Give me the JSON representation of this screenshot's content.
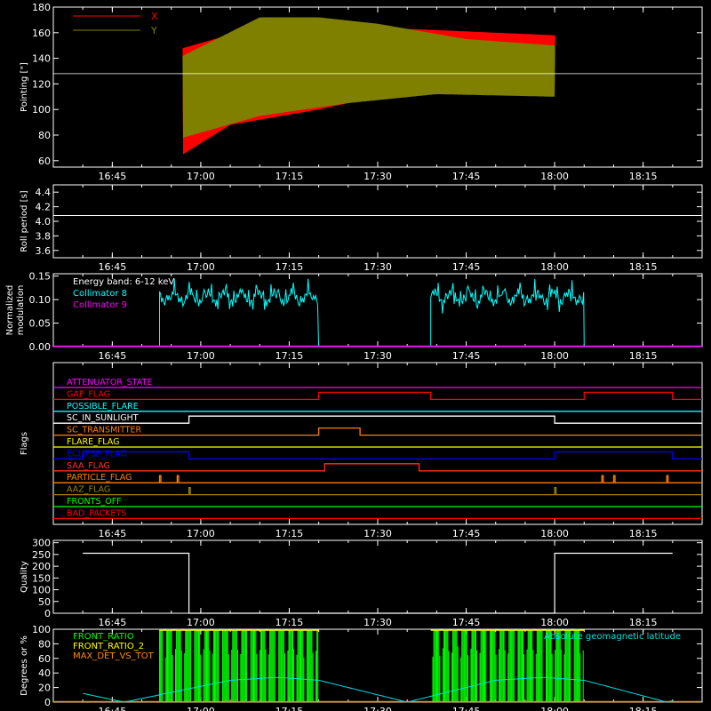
{
  "colors": {
    "background": "#000000",
    "axes": "#ffffff",
    "pointing_x": "#ff0000",
    "pointing_y": "#808000",
    "collimator_8": "#00ffff",
    "collimator_9": "#ff00ff",
    "front_ratio": "#00ff00",
    "front_ratio_2": "#ffff00",
    "max_det_vs_tot": "#ff8c00",
    "geomag": "#00e0e0"
  },
  "time_ticks": [
    "16:45",
    "17:00",
    "17:15",
    "17:30",
    "17:45",
    "18:00",
    "18:15"
  ],
  "chart_data": [
    {
      "type": "line",
      "panel": "pointing",
      "ylabel": "Pointing [\"]",
      "ylim": [
        55,
        180
      ],
      "yticks": [
        60,
        80,
        100,
        120,
        140,
        160,
        180
      ],
      "legend": [
        "X",
        "Y"
      ],
      "legend_placement": "top-left",
      "coverage": [
        "16:57",
        "18:00"
      ],
      "series": [
        {
          "name": "X",
          "envelope_upper": [
            {
              "t": "16:57",
              "v": 148
            },
            {
              "t": "17:10",
              "v": 165
            },
            {
              "t": "17:30",
              "v": 164
            },
            {
              "t": "17:40",
              "v": 162
            },
            {
              "t": "18:00",
              "v": 158
            }
          ],
          "envelope_lower": [
            {
              "t": "16:57",
              "v": 65
            },
            {
              "t": "17:05",
              "v": 88
            },
            {
              "t": "17:20",
              "v": 100
            },
            {
              "t": "17:40",
              "v": 120
            },
            {
              "t": "18:00",
              "v": 132
            }
          ]
        },
        {
          "name": "Y",
          "envelope_upper": [
            {
              "t": "16:57",
              "v": 142
            },
            {
              "t": "17:10",
              "v": 172
            },
            {
              "t": "17:20",
              "v": 172
            },
            {
              "t": "17:30",
              "v": 167
            },
            {
              "t": "17:45",
              "v": 155
            },
            {
              "t": "18:00",
              "v": 150
            }
          ],
          "envelope_lower": [
            {
              "t": "16:57",
              "v": 78
            },
            {
              "t": "17:10",
              "v": 95
            },
            {
              "t": "17:25",
              "v": 105
            },
            {
              "t": "17:40",
              "v": 112
            },
            {
              "t": "18:00",
              "v": 110
            }
          ]
        }
      ],
      "reference_line": 128
    },
    {
      "type": "line",
      "panel": "roll_period",
      "ylabel": "Roll period [s]",
      "ylim": [
        3.5,
        4.5
      ],
      "yticks": [
        "3.6",
        "3.8",
        "4.0",
        "4.2",
        "4.4"
      ],
      "value": 4.08
    },
    {
      "type": "line",
      "panel": "modulation",
      "ylabel": "Normalized modulation",
      "ylabel_lines": [
        "Normalized",
        "modulation"
      ],
      "ylim": [
        0,
        0.155
      ],
      "yticks": [
        "0.00",
        "0.05",
        "0.10",
        "0.15"
      ],
      "annotation": "Energy band: 6-12 keV",
      "legend": [
        "Collimator 8",
        "Collimator 9"
      ],
      "series": [
        {
          "name": "Collimator 8",
          "intervals": [
            [
              "16:53",
              "17:20"
            ],
            [
              "17:39",
              "18:05"
            ]
          ],
          "level": 0.105
        },
        {
          "name": "Collimator 9",
          "level": 0.0
        }
      ]
    },
    {
      "type": "table",
      "panel": "flags",
      "ylabel": "Flags",
      "flags": [
        {
          "name": "ATTENUATOR_STATE",
          "color": "#ff00ff",
          "highs": []
        },
        {
          "name": "GAP_FLAG",
          "color": "#ff0000",
          "highs": [
            [
              "17:20",
              "17:39"
            ],
            [
              "18:05",
              "18:20"
            ]
          ]
        },
        {
          "name": "POSSIBLE_FLARE",
          "color": "#00ffff",
          "highs": []
        },
        {
          "name": "SC_IN_SUNLIGHT",
          "color": "#ffffff",
          "highs": [
            [
              "16:58",
              "18:00"
            ]
          ]
        },
        {
          "name": "SC_TRANSMITTER",
          "color": "#ff8000",
          "highs": [
            [
              "17:20",
              "17:27"
            ]
          ]
        },
        {
          "name": "FLARE_FLAG",
          "color": "#ffff00",
          "highs": []
        },
        {
          "name": "ECLIPSE_FLAG",
          "color": "#0000ff",
          "highs": [
            [
              "16:40",
              "16:58"
            ],
            [
              "18:00",
              "18:20"
            ]
          ]
        },
        {
          "name": "SAA_FLAG",
          "color": "#ff3020",
          "highs": [
            [
              "17:21",
              "17:37"
            ]
          ]
        },
        {
          "name": "PARTICLE_FLAG",
          "color": "#ff8000",
          "highs": [
            [
              "16:53",
              "16:53"
            ],
            [
              "16:56",
              "16:56"
            ],
            [
              "18:08",
              "18:08"
            ],
            [
              "18:10",
              "18:10"
            ],
            [
              "18:19",
              "18:19"
            ]
          ]
        },
        {
          "name": "AAZ_FLAG",
          "color": "#a08000",
          "highs": [
            [
              "16:58",
              "16:58"
            ],
            [
              "18:00",
              "18:00"
            ]
          ]
        },
        {
          "name": "FRONTS_OFF",
          "color": "#00ff00",
          "highs": []
        },
        {
          "name": "BAD_PACKETS",
          "color": "#ff0000",
          "highs": []
        }
      ]
    },
    {
      "type": "line",
      "panel": "quality",
      "ylabel": "Quality",
      "ylim": [
        0,
        310
      ],
      "yticks": [
        0,
        50,
        100,
        150,
        200,
        250,
        300
      ],
      "points": [
        {
          "t": "16:40",
          "v": 255
        },
        {
          "t": "16:58",
          "v": 255
        },
        {
          "t": "16:58",
          "v": 0
        },
        {
          "t": "18:00",
          "v": 0
        },
        {
          "t": "18:00",
          "v": 255
        },
        {
          "t": "18:20",
          "v": 255
        }
      ]
    },
    {
      "type": "bar",
      "panel": "front_ratio",
      "ylabel": "Degrees or %",
      "ylim": [
        0,
        100
      ],
      "yticks": [
        0,
        20,
        40,
        60,
        80,
        100
      ],
      "legend": [
        "FRONT_RATIO",
        "FRONT_RATIO_2",
        "MAX_DET_VS_TOT"
      ],
      "legend_placement": "top-left",
      "annotation": "Absolute geomagnetic latitude",
      "intervals": [
        [
          "16:53",
          "17:20"
        ],
        [
          "17:39",
          "18:05"
        ]
      ],
      "geomag_latitude": [
        {
          "t": "16:40",
          "v": 12
        },
        {
          "t": "16:47",
          "v": 0
        },
        {
          "t": "17:05",
          "v": 30
        },
        {
          "t": "17:13",
          "v": 34
        },
        {
          "t": "17:20",
          "v": 30
        },
        {
          "t": "17:35",
          "v": 0
        },
        {
          "t": "17:50",
          "v": 30
        },
        {
          "t": "17:58",
          "v": 34
        },
        {
          "t": "18:05",
          "v": 30
        },
        {
          "t": "18:19",
          "v": 0
        },
        {
          "t": "18:20",
          "v": 2
        }
      ]
    }
  ]
}
